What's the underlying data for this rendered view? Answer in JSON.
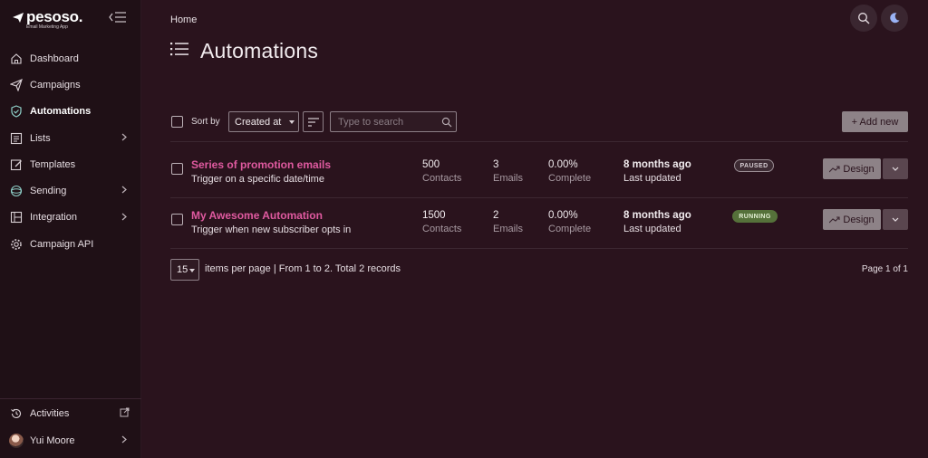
{
  "app": {
    "name": "pesoso.",
    "tagline": "Email Marketing App"
  },
  "sidebar": {
    "items": [
      {
        "label": "Dashboard",
        "icon": "home-icon",
        "has_children": false,
        "active": false
      },
      {
        "label": "Campaigns",
        "icon": "paper-plane-icon",
        "has_children": false,
        "active": false
      },
      {
        "label": "Automations",
        "icon": "shield-check-icon",
        "has_children": false,
        "active": true
      },
      {
        "label": "Lists",
        "icon": "list-icon",
        "has_children": true,
        "active": false
      },
      {
        "label": "Templates",
        "icon": "edit-icon",
        "has_children": false,
        "active": false
      },
      {
        "label": "Sending",
        "icon": "globe-icon",
        "has_children": true,
        "active": false
      },
      {
        "label": "Integration",
        "icon": "integration-icon",
        "has_children": true,
        "active": false
      },
      {
        "label": "Campaign API",
        "icon": "gear-icon",
        "has_children": false,
        "active": false
      }
    ],
    "bottom": {
      "activities_label": "Activities",
      "user_name": "Yui Moore"
    }
  },
  "header": {
    "breadcrumb": "Home",
    "title": "Automations"
  },
  "toolbar": {
    "sort_label": "Sort by",
    "sort_value": "Created at",
    "search_placeholder": "Type to search",
    "add_label": "+ Add new"
  },
  "automations": [
    {
      "title": "Series of promotion emails",
      "trigger": "Trigger on a specific date/time",
      "contacts": "500",
      "contacts_label": "Contacts",
      "emails": "3",
      "emails_label": "Emails",
      "complete": "0.00%",
      "complete_label": "Complete",
      "updated": "8 months ago",
      "updated_label": "Last updated",
      "status": "PAUSED",
      "design_label": "Design"
    },
    {
      "title": "My Awesome Automation",
      "trigger": "Trigger when new subscriber opts in",
      "contacts": "1500",
      "contacts_label": "Contacts",
      "emails": "2",
      "emails_label": "Emails",
      "complete": "0.00%",
      "complete_label": "Complete",
      "updated": "8 months ago",
      "updated_label": "Last updated",
      "status": "RUNNING",
      "design_label": "Design"
    }
  ],
  "pagination": {
    "per_page": "15",
    "summary": "items per page  | From 1 to 2. Total 2 records",
    "page_of": "Page 1 of 1"
  },
  "colors": {
    "background": "#2a131d",
    "sidebar": "#1f1016",
    "accent_link": "#e05aa0",
    "running": "#55713a",
    "button": "#8d8287"
  }
}
